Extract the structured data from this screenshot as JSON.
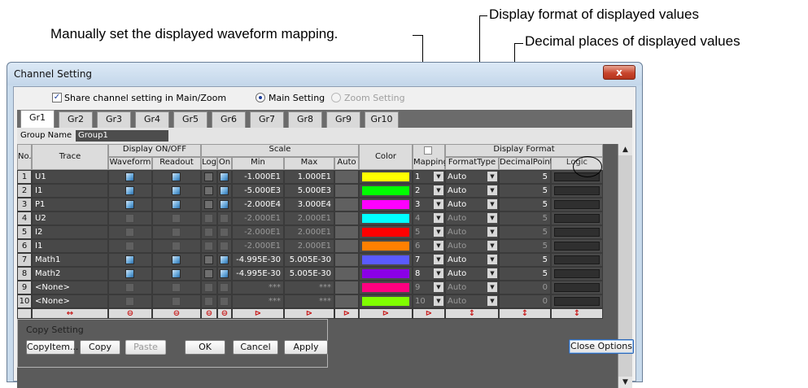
{
  "callouts": {
    "display_format": "Display format of displayed values",
    "mapping": "Manually set the displayed waveform mapping.",
    "decimal_places": "Decimal places of displayed values"
  },
  "window": {
    "title": "Channel Setting",
    "close_glyph": "x"
  },
  "share": {
    "checkbox_label": "Share channel setting in Main/Zoom",
    "checked": true
  },
  "modes": {
    "main": "Main Setting",
    "zoom": "Zoom Setting",
    "selected": "main"
  },
  "tabs": [
    "Gr1",
    "Gr2",
    "Gr3",
    "Gr4",
    "Gr5",
    "Gr6",
    "Gr7",
    "Gr8",
    "Gr9",
    "Gr10"
  ],
  "group": {
    "label": "Group Name",
    "value": "Group1"
  },
  "headers": {
    "no": "No.",
    "trace": "Trace",
    "display": "Display ON/OFF",
    "waveform": "Waveform",
    "readout": "Readout",
    "scale": "Scale",
    "log": "Log",
    "on": "On",
    "min": "Min",
    "max": "Max",
    "auto": "Auto",
    "color": "Color",
    "mapping": "Mapping",
    "display_format": "Display Format",
    "format_type": "FormatType",
    "decimal_point": "DecimalPoint",
    "logic": "Logic"
  },
  "rows": [
    {
      "no": "1",
      "trace": "U1",
      "waveform": true,
      "readout": true,
      "log": false,
      "on": true,
      "min": "-1.000E1",
      "max": "1.000E1",
      "color": "#ffff00",
      "mapping": "1",
      "format": "Auto",
      "decimal": "5",
      "active": true
    },
    {
      "no": "2",
      "trace": "I1",
      "waveform": true,
      "readout": true,
      "log": false,
      "on": true,
      "min": "-5.000E3",
      "max": "5.000E3",
      "color": "#00ff00",
      "mapping": "2",
      "format": "Auto",
      "decimal": "5",
      "active": true
    },
    {
      "no": "3",
      "trace": "P1",
      "waveform": true,
      "readout": true,
      "log": false,
      "on": true,
      "min": "-2.000E4",
      "max": "3.000E4",
      "color": "#ff00ff",
      "mapping": "3",
      "format": "Auto",
      "decimal": "5",
      "active": true
    },
    {
      "no": "4",
      "trace": "U2",
      "waveform": false,
      "readout": false,
      "log": false,
      "on": false,
      "min": "-2.000E1",
      "max": "2.000E1",
      "color": "#00ffff",
      "mapping": "4",
      "format": "Auto",
      "decimal": "5",
      "active": false
    },
    {
      "no": "5",
      "trace": "I2",
      "waveform": false,
      "readout": false,
      "log": false,
      "on": false,
      "min": "-2.000E1",
      "max": "2.000E1",
      "color": "#ff0000",
      "mapping": "5",
      "format": "Auto",
      "decimal": "5",
      "active": false
    },
    {
      "no": "6",
      "trace": "I1",
      "waveform": false,
      "readout": false,
      "log": false,
      "on": false,
      "min": "-2.000E1",
      "max": "2.000E1",
      "color": "#ff8000",
      "mapping": "6",
      "format": "Auto",
      "decimal": "5",
      "active": false
    },
    {
      "no": "7",
      "trace": "Math1",
      "waveform": true,
      "readout": true,
      "log": false,
      "on": true,
      "min": "-4.995E-30",
      "max": "5.005E-30",
      "color": "#5a5aff",
      "mapping": "7",
      "format": "Auto",
      "decimal": "5",
      "active": true
    },
    {
      "no": "8",
      "trace": "Math2",
      "waveform": true,
      "readout": true,
      "log": false,
      "on": true,
      "min": "-4.995E-30",
      "max": "5.005E-30",
      "color": "#8a00e6",
      "mapping": "8",
      "format": "Auto",
      "decimal": "5",
      "active": true
    },
    {
      "no": "9",
      "trace": "<None>",
      "waveform": false,
      "readout": false,
      "log": false,
      "on": false,
      "min": "***",
      "max": "***",
      "color": "#ff0080",
      "mapping": "9",
      "format": "Auto",
      "decimal": "0",
      "active": false
    },
    {
      "no": "10",
      "trace": "<None>",
      "waveform": false,
      "readout": false,
      "log": false,
      "on": false,
      "min": "***",
      "max": "***",
      "color": "#80ff00",
      "mapping": "10",
      "format": "Auto",
      "decimal": "0",
      "active": false
    }
  ],
  "arrow_row": {
    "trace": "↔",
    "waveform": "⊖",
    "readout": "⊖",
    "log": "⊖",
    "on": "⊖",
    "min": "⊳",
    "max": "⊳",
    "auto": "⊳",
    "color": "⊳",
    "mapping": "⊳",
    "format": "↕",
    "decimal": "↕",
    "logic": "↕"
  },
  "copy": {
    "title": "Copy Setting",
    "copy_item": "CopyItem...",
    "copy": "Copy",
    "paste": "Paste"
  },
  "buttons": {
    "ok": "OK",
    "cancel": "Cancel",
    "apply": "Apply",
    "close_options": "Close Options"
  }
}
